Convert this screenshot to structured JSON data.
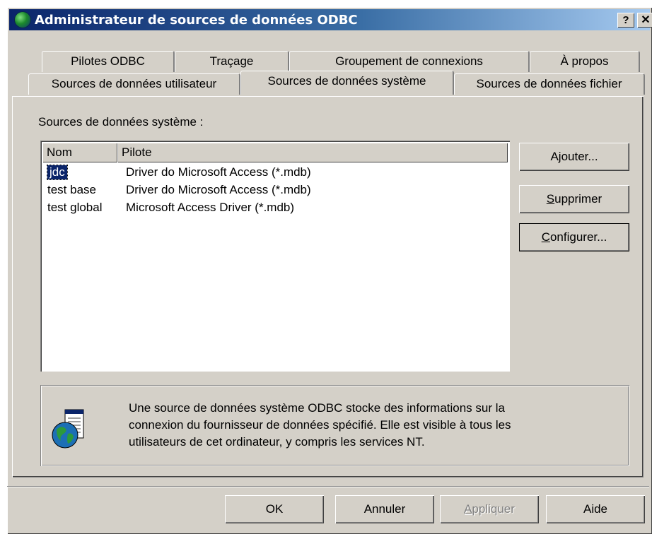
{
  "window": {
    "title": "Administrateur de sources de données ODBC",
    "help_label": "?",
    "close_label": "✕"
  },
  "tabs_back": [
    {
      "label": "Pilotes ODBC"
    },
    {
      "label": "Traçage"
    },
    {
      "label": "Groupement de connexions"
    },
    {
      "label": "À propos"
    }
  ],
  "tabs_front": [
    {
      "label": "Sources de données utilisateur",
      "active": false
    },
    {
      "label": "Sources de données système",
      "active": true
    },
    {
      "label": "Sources de données fichier",
      "active": false
    }
  ],
  "section_label": "Sources de données système :",
  "list": {
    "columns": [
      "Nom",
      "Pilote"
    ],
    "rows": [
      {
        "name": "jdc",
        "driver": "Driver do Microsoft Access (*.mdb)",
        "selected": true
      },
      {
        "name": "test base",
        "driver": "Driver do Microsoft Access (*.mdb)",
        "selected": false
      },
      {
        "name": "test global",
        "driver": "Microsoft Access Driver (*.mdb)",
        "selected": false
      }
    ]
  },
  "side_buttons": {
    "add": {
      "pre": "A",
      "key": "j",
      "post": "outer..."
    },
    "remove": {
      "pre": "",
      "key": "S",
      "post": "upprimer"
    },
    "configure": {
      "pre": "",
      "key": "C",
      "post": "onfigurer..."
    }
  },
  "info": {
    "line1": "Une source de données système ODBC stocke des informations sur la",
    "line2": "connexion du fournisseur de données spécifié. Elle est visible à tous les",
    "line3": "utilisateurs de cet ordinateur, y compris les services NT.",
    "icon": "odbc-globe-document-icon"
  },
  "footer_buttons": {
    "ok": "OK",
    "cancel": "Annuler",
    "apply": {
      "pre": "",
      "key": "A",
      "post": "ppliquer"
    },
    "help": "Aide"
  }
}
